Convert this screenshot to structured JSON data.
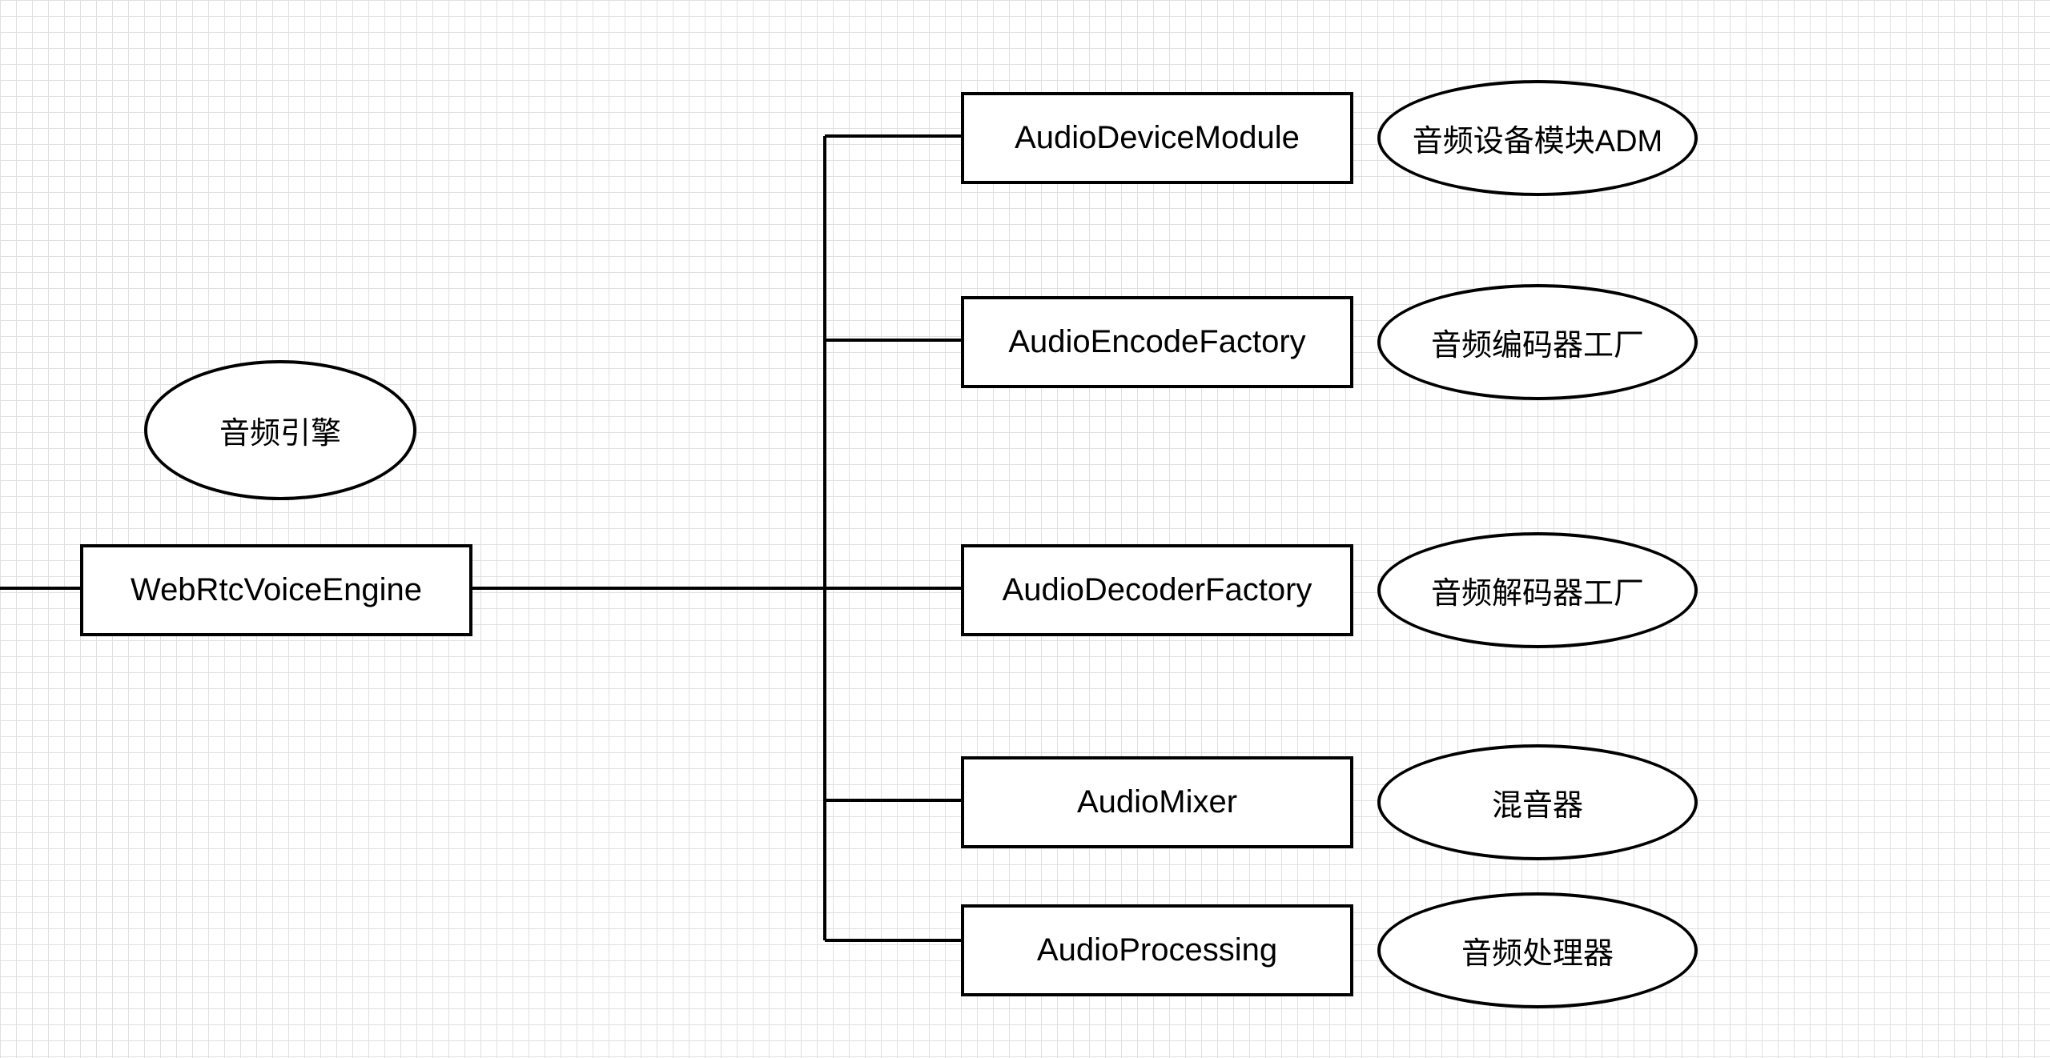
{
  "root": {
    "box_label": "WebRtcVoiceEngine",
    "ellipse_label": "音频引擎"
  },
  "children": [
    {
      "box_label": "AudioDeviceModule",
      "ellipse_label": "音频设备模块ADM"
    },
    {
      "box_label": "AudioEncodeFactory",
      "ellipse_label": "音频编码器工厂"
    },
    {
      "box_label": "AudioDecoderFactory",
      "ellipse_label": "音频解码器工厂"
    },
    {
      "box_label": "AudioMixer",
      "ellipse_label": "混音器"
    },
    {
      "box_label": "AudioProcessing",
      "ellipse_label": "音频处理器"
    }
  ]
}
